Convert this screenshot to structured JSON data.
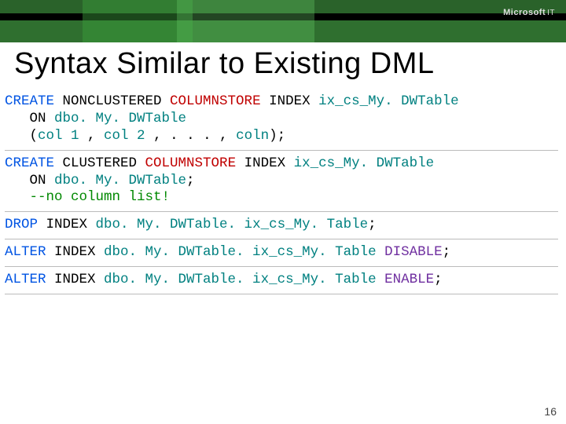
{
  "brand": {
    "name": "Microsoft",
    "suffix": "IT"
  },
  "title": "Syntax Similar to Existing DML",
  "page": "16",
  "blocks": [
    {
      "lines": [
        {
          "segs": [
            {
              "t": "CREATE",
              "c": "kw-blue"
            },
            {
              "t": " NONCLUSTERED "
            },
            {
              "t": "COLUMNSTORE",
              "c": "kw-red"
            },
            {
              "t": " INDEX "
            },
            {
              "t": "ix_cs_My. DWTable",
              "c": "kw-teal"
            }
          ]
        },
        {
          "segs": [
            {
              "t": "   ON "
            },
            {
              "t": "dbo. My. DWTable",
              "c": "kw-teal"
            }
          ]
        },
        {
          "segs": [
            {
              "t": "   ("
            },
            {
              "t": "col 1",
              "c": "kw-teal"
            },
            {
              "t": " , "
            },
            {
              "t": "col 2",
              "c": "kw-teal"
            },
            {
              "t": " , . . . , "
            },
            {
              "t": "coln",
              "c": "kw-teal"
            },
            {
              "t": ");"
            }
          ]
        }
      ]
    },
    {
      "lines": [
        {
          "segs": [
            {
              "t": "CREATE",
              "c": "kw-blue"
            },
            {
              "t": " CLUSTERED "
            },
            {
              "t": "COLUMNSTORE",
              "c": "kw-red"
            },
            {
              "t": " INDEX "
            },
            {
              "t": "ix_cs_My. DWTable",
              "c": "kw-teal"
            }
          ]
        },
        {
          "segs": [
            {
              "t": "   ON "
            },
            {
              "t": "dbo. My. DWTable",
              "c": "kw-teal"
            },
            {
              "t": ";"
            }
          ]
        },
        {
          "segs": [
            {
              "t": "   "
            },
            {
              "t": "--no column list!",
              "c": "kw-green"
            }
          ]
        }
      ]
    },
    {
      "lines": [
        {
          "segs": [
            {
              "t": "DROP",
              "c": "kw-blue"
            },
            {
              "t": " INDEX "
            },
            {
              "t": "dbo. My. DWTable. ix_cs_My. Table",
              "c": "kw-teal"
            },
            {
              "t": ";"
            }
          ]
        }
      ]
    },
    {
      "lines": [
        {
          "segs": [
            {
              "t": "ALTER",
              "c": "kw-blue"
            },
            {
              "t": " INDEX "
            },
            {
              "t": "dbo. My. DWTable. ix_cs_My. Table",
              "c": "kw-teal"
            },
            {
              "t": " "
            },
            {
              "t": "DISABLE",
              "c": "kw-purple"
            },
            {
              "t": ";"
            }
          ]
        }
      ]
    },
    {
      "lines": [
        {
          "segs": [
            {
              "t": "ALTER",
              "c": "kw-blue"
            },
            {
              "t": " INDEX "
            },
            {
              "t": "dbo. My. DWTable. ix_cs_My. Table",
              "c": "kw-teal"
            },
            {
              "t": " "
            },
            {
              "t": "ENABLE",
              "c": "kw-purple"
            },
            {
              "t": ";"
            }
          ]
        }
      ]
    }
  ]
}
